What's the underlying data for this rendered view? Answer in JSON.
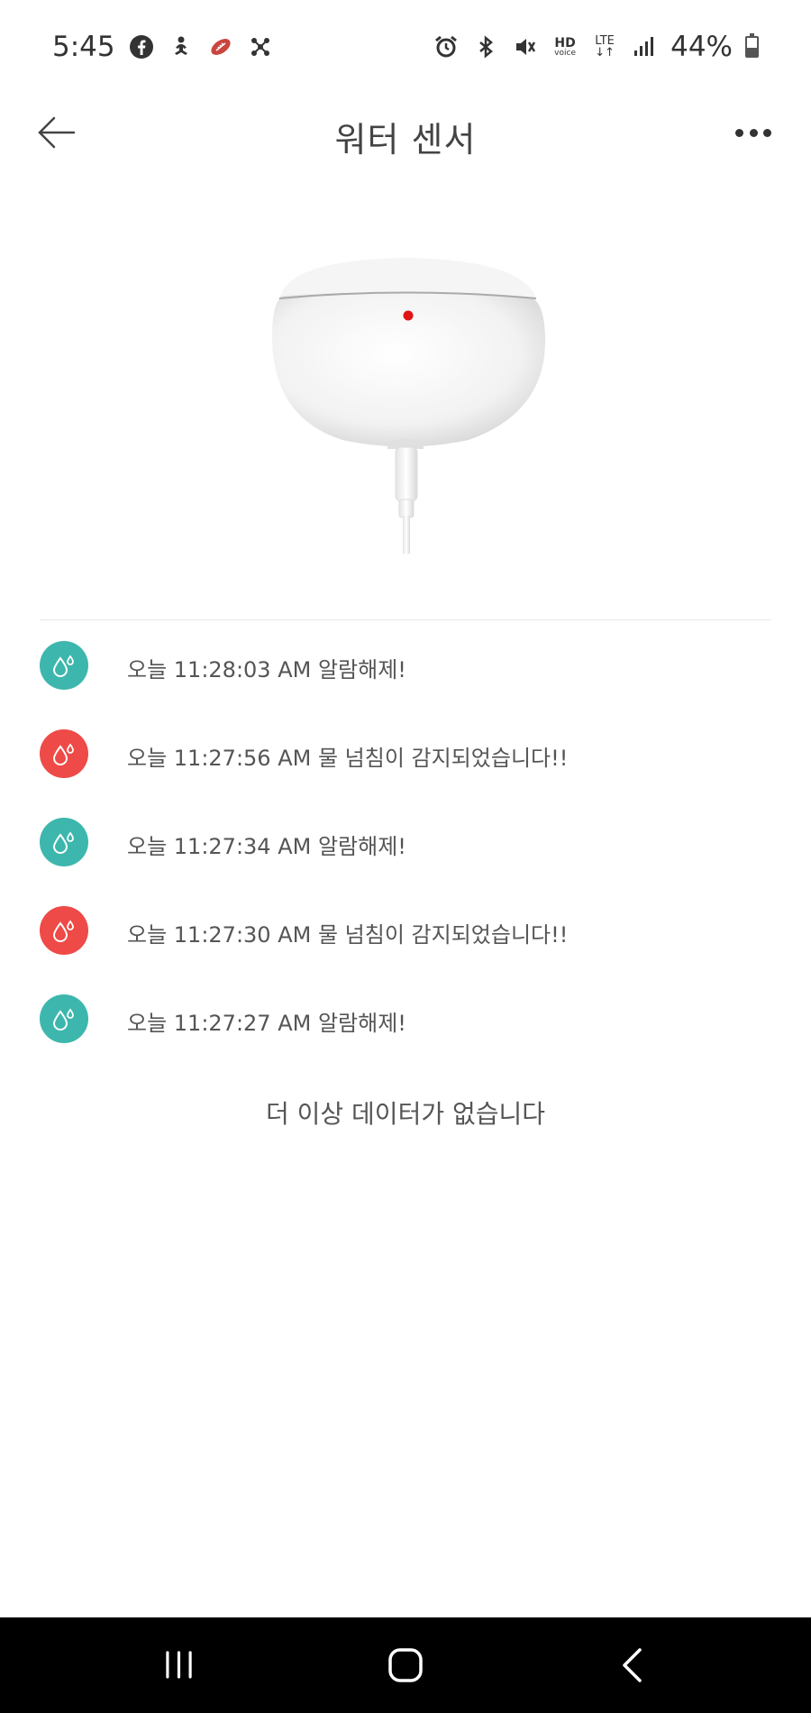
{
  "status_bar": {
    "time": "5:45",
    "battery": "44%",
    "hd_label": "HD",
    "voice_label": "voice",
    "lte_label": "LTE",
    "icons": [
      "facebook-icon",
      "meditation-icon",
      "rugby-ball-icon",
      "network-icon",
      "alarm-icon",
      "bluetooth-icon",
      "mute-icon",
      "hd-voice-icon",
      "lte-icon",
      "signal-icon",
      "battery-icon"
    ]
  },
  "header": {
    "title": "워터 센서",
    "back_icon": "back-arrow-icon",
    "more_icon": "more-options-icon"
  },
  "device": {
    "icon": "water-sensor-image"
  },
  "history": [
    {
      "text": "오늘 11:28:03 AM 알람해제!",
      "status": "cleared",
      "color": "#3db7ad"
    },
    {
      "text": "오늘 11:27:56 AM 물 넘침이 감지되었습니다!!",
      "status": "alert",
      "color": "#ee4a47"
    },
    {
      "text": "오늘 11:27:34 AM 알람해제!",
      "status": "cleared",
      "color": "#3db7ad"
    },
    {
      "text": "오늘 11:27:30 AM 물 넘침이 감지되었습니다!!",
      "status": "alert",
      "color": "#ee4a47"
    },
    {
      "text": "오늘 11:27:27 AM 알람해제!",
      "status": "cleared",
      "color": "#3db7ad"
    }
  ],
  "footer_message": "더 이상 데이터가 없습니다",
  "nav": [
    "recent-apps-icon",
    "home-icon",
    "back-icon"
  ]
}
